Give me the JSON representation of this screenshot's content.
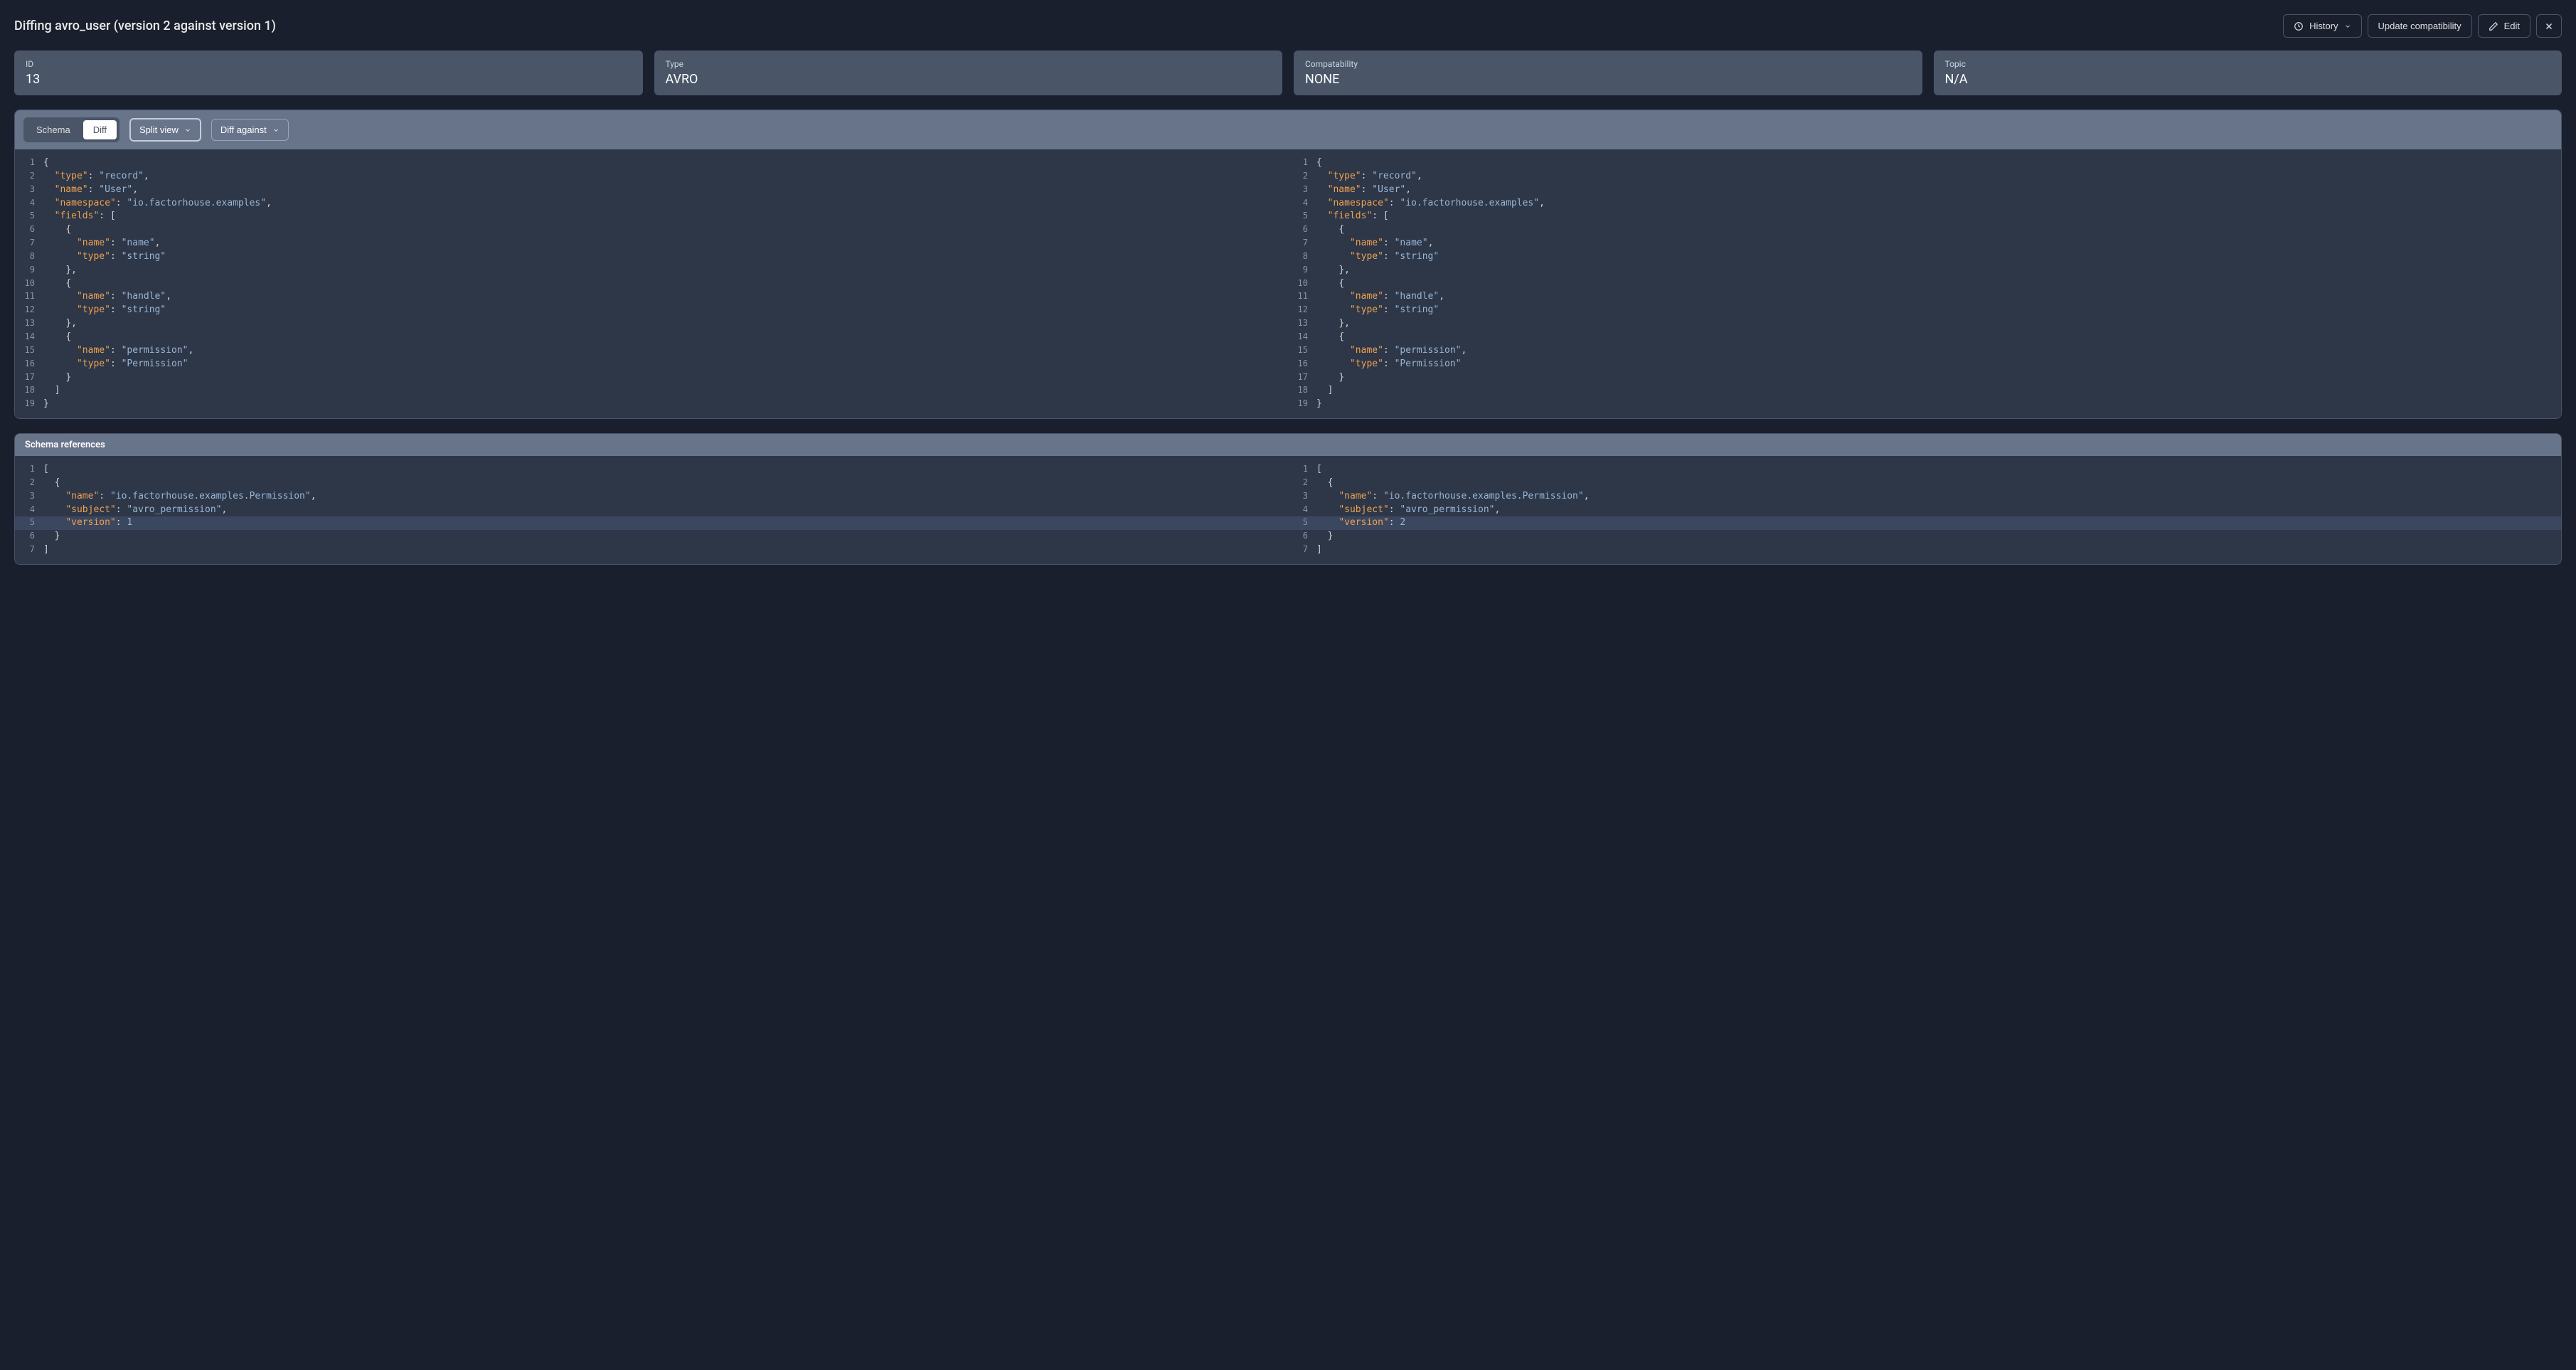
{
  "title": "Diffing avro_user (version 2 against version 1)",
  "actions": {
    "history": "History",
    "update": "Update compatibility",
    "edit": "Edit"
  },
  "cards": [
    {
      "label": "ID",
      "value": "13"
    },
    {
      "label": "Type",
      "value": "AVRO"
    },
    {
      "label": "Compatability",
      "value": "NONE"
    },
    {
      "label": "Topic",
      "value": "N/A"
    }
  ],
  "toolbar": {
    "schema_tab": "Schema",
    "diff_tab": "Diff",
    "split_view": "Split view",
    "diff_against": "Diff against"
  },
  "schema_left": [
    {
      "n": 1,
      "tokens": [
        {
          "t": "punc",
          "v": "{"
        }
      ]
    },
    {
      "n": 2,
      "tokens": [
        {
          "t": "ind",
          "v": "  "
        },
        {
          "t": "key",
          "v": "\"type\""
        },
        {
          "t": "punc",
          "v": ": "
        },
        {
          "t": "str",
          "v": "\"record\""
        },
        {
          "t": "punc",
          "v": ","
        }
      ]
    },
    {
      "n": 3,
      "tokens": [
        {
          "t": "ind",
          "v": "  "
        },
        {
          "t": "key",
          "v": "\"name\""
        },
        {
          "t": "punc",
          "v": ": "
        },
        {
          "t": "str",
          "v": "\"User\""
        },
        {
          "t": "punc",
          "v": ","
        }
      ]
    },
    {
      "n": 4,
      "tokens": [
        {
          "t": "ind",
          "v": "  "
        },
        {
          "t": "key",
          "v": "\"namespace\""
        },
        {
          "t": "punc",
          "v": ": "
        },
        {
          "t": "str",
          "v": "\"io.factorhouse.examples\""
        },
        {
          "t": "punc",
          "v": ","
        }
      ]
    },
    {
      "n": 5,
      "tokens": [
        {
          "t": "ind",
          "v": "  "
        },
        {
          "t": "key",
          "v": "\"fields\""
        },
        {
          "t": "punc",
          "v": ": ["
        }
      ]
    },
    {
      "n": 6,
      "tokens": [
        {
          "t": "ind",
          "v": "    "
        },
        {
          "t": "punc",
          "v": "{"
        }
      ]
    },
    {
      "n": 7,
      "tokens": [
        {
          "t": "ind",
          "v": "      "
        },
        {
          "t": "key",
          "v": "\"name\""
        },
        {
          "t": "punc",
          "v": ": "
        },
        {
          "t": "str",
          "v": "\"name\""
        },
        {
          "t": "punc",
          "v": ","
        }
      ]
    },
    {
      "n": 8,
      "tokens": [
        {
          "t": "ind",
          "v": "      "
        },
        {
          "t": "key",
          "v": "\"type\""
        },
        {
          "t": "punc",
          "v": ": "
        },
        {
          "t": "str",
          "v": "\"string\""
        }
      ]
    },
    {
      "n": 9,
      "tokens": [
        {
          "t": "ind",
          "v": "    "
        },
        {
          "t": "punc",
          "v": "},"
        }
      ]
    },
    {
      "n": 10,
      "tokens": [
        {
          "t": "ind",
          "v": "    "
        },
        {
          "t": "punc",
          "v": "{"
        }
      ]
    },
    {
      "n": 11,
      "tokens": [
        {
          "t": "ind",
          "v": "      "
        },
        {
          "t": "key",
          "v": "\"name\""
        },
        {
          "t": "punc",
          "v": ": "
        },
        {
          "t": "str",
          "v": "\"handle\""
        },
        {
          "t": "punc",
          "v": ","
        }
      ]
    },
    {
      "n": 12,
      "tokens": [
        {
          "t": "ind",
          "v": "      "
        },
        {
          "t": "key",
          "v": "\"type\""
        },
        {
          "t": "punc",
          "v": ": "
        },
        {
          "t": "str",
          "v": "\"string\""
        }
      ]
    },
    {
      "n": 13,
      "tokens": [
        {
          "t": "ind",
          "v": "    "
        },
        {
          "t": "punc",
          "v": "},"
        }
      ]
    },
    {
      "n": 14,
      "tokens": [
        {
          "t": "ind",
          "v": "    "
        },
        {
          "t": "punc",
          "v": "{"
        }
      ]
    },
    {
      "n": 15,
      "tokens": [
        {
          "t": "ind",
          "v": "      "
        },
        {
          "t": "key",
          "v": "\"name\""
        },
        {
          "t": "punc",
          "v": ": "
        },
        {
          "t": "str",
          "v": "\"permission\""
        },
        {
          "t": "punc",
          "v": ","
        }
      ]
    },
    {
      "n": 16,
      "tokens": [
        {
          "t": "ind",
          "v": "      "
        },
        {
          "t": "key",
          "v": "\"type\""
        },
        {
          "t": "punc",
          "v": ": "
        },
        {
          "t": "str",
          "v": "\"Permission\""
        }
      ]
    },
    {
      "n": 17,
      "tokens": [
        {
          "t": "ind",
          "v": "    "
        },
        {
          "t": "punc",
          "v": "}"
        }
      ]
    },
    {
      "n": 18,
      "tokens": [
        {
          "t": "ind",
          "v": "  "
        },
        {
          "t": "punc",
          "v": "]"
        }
      ]
    },
    {
      "n": 19,
      "tokens": [
        {
          "t": "punc",
          "v": "}"
        }
      ]
    }
  ],
  "schema_right": [
    {
      "n": 1,
      "tokens": [
        {
          "t": "punc",
          "v": "{"
        }
      ]
    },
    {
      "n": 2,
      "tokens": [
        {
          "t": "ind",
          "v": "  "
        },
        {
          "t": "key",
          "v": "\"type\""
        },
        {
          "t": "punc",
          "v": ": "
        },
        {
          "t": "str",
          "v": "\"record\""
        },
        {
          "t": "punc",
          "v": ","
        }
      ]
    },
    {
      "n": 3,
      "tokens": [
        {
          "t": "ind",
          "v": "  "
        },
        {
          "t": "key",
          "v": "\"name\""
        },
        {
          "t": "punc",
          "v": ": "
        },
        {
          "t": "str",
          "v": "\"User\""
        },
        {
          "t": "punc",
          "v": ","
        }
      ]
    },
    {
      "n": 4,
      "tokens": [
        {
          "t": "ind",
          "v": "  "
        },
        {
          "t": "key",
          "v": "\"namespace\""
        },
        {
          "t": "punc",
          "v": ": "
        },
        {
          "t": "str",
          "v": "\"io.factorhouse.examples\""
        },
        {
          "t": "punc",
          "v": ","
        }
      ]
    },
    {
      "n": 5,
      "tokens": [
        {
          "t": "ind",
          "v": "  "
        },
        {
          "t": "key",
          "v": "\"fields\""
        },
        {
          "t": "punc",
          "v": ": ["
        }
      ]
    },
    {
      "n": 6,
      "tokens": [
        {
          "t": "ind",
          "v": "    "
        },
        {
          "t": "punc",
          "v": "{"
        }
      ]
    },
    {
      "n": 7,
      "tokens": [
        {
          "t": "ind",
          "v": "      "
        },
        {
          "t": "key",
          "v": "\"name\""
        },
        {
          "t": "punc",
          "v": ": "
        },
        {
          "t": "str",
          "v": "\"name\""
        },
        {
          "t": "punc",
          "v": ","
        }
      ]
    },
    {
      "n": 8,
      "tokens": [
        {
          "t": "ind",
          "v": "      "
        },
        {
          "t": "key",
          "v": "\"type\""
        },
        {
          "t": "punc",
          "v": ": "
        },
        {
          "t": "str",
          "v": "\"string\""
        }
      ]
    },
    {
      "n": 9,
      "tokens": [
        {
          "t": "ind",
          "v": "    "
        },
        {
          "t": "punc",
          "v": "},"
        }
      ]
    },
    {
      "n": 10,
      "tokens": [
        {
          "t": "ind",
          "v": "    "
        },
        {
          "t": "punc",
          "v": "{"
        }
      ]
    },
    {
      "n": 11,
      "tokens": [
        {
          "t": "ind",
          "v": "      "
        },
        {
          "t": "key",
          "v": "\"name\""
        },
        {
          "t": "punc",
          "v": ": "
        },
        {
          "t": "str",
          "v": "\"handle\""
        },
        {
          "t": "punc",
          "v": ","
        }
      ]
    },
    {
      "n": 12,
      "tokens": [
        {
          "t": "ind",
          "v": "      "
        },
        {
          "t": "key",
          "v": "\"type\""
        },
        {
          "t": "punc",
          "v": ": "
        },
        {
          "t": "str",
          "v": "\"string\""
        }
      ]
    },
    {
      "n": 13,
      "tokens": [
        {
          "t": "ind",
          "v": "    "
        },
        {
          "t": "punc",
          "v": "},"
        }
      ]
    },
    {
      "n": 14,
      "tokens": [
        {
          "t": "ind",
          "v": "    "
        },
        {
          "t": "punc",
          "v": "{"
        }
      ]
    },
    {
      "n": 15,
      "tokens": [
        {
          "t": "ind",
          "v": "      "
        },
        {
          "t": "key",
          "v": "\"name\""
        },
        {
          "t": "punc",
          "v": ": "
        },
        {
          "t": "str",
          "v": "\"permission\""
        },
        {
          "t": "punc",
          "v": ","
        }
      ]
    },
    {
      "n": 16,
      "tokens": [
        {
          "t": "ind",
          "v": "      "
        },
        {
          "t": "key",
          "v": "\"type\""
        },
        {
          "t": "punc",
          "v": ": "
        },
        {
          "t": "str",
          "v": "\"Permission\""
        }
      ]
    },
    {
      "n": 17,
      "tokens": [
        {
          "t": "ind",
          "v": "    "
        },
        {
          "t": "punc",
          "v": "}"
        }
      ]
    },
    {
      "n": 18,
      "tokens": [
        {
          "t": "ind",
          "v": "  "
        },
        {
          "t": "punc",
          "v": "]"
        }
      ]
    },
    {
      "n": 19,
      "tokens": [
        {
          "t": "punc",
          "v": "}"
        }
      ]
    }
  ],
  "refs_header": "Schema references",
  "refs_left": [
    {
      "n": 1,
      "tokens": [
        {
          "t": "punc",
          "v": "["
        }
      ]
    },
    {
      "n": 2,
      "tokens": [
        {
          "t": "ind",
          "v": "  "
        },
        {
          "t": "punc",
          "v": "{"
        }
      ]
    },
    {
      "n": 3,
      "tokens": [
        {
          "t": "ind",
          "v": "    "
        },
        {
          "t": "key",
          "v": "\"name\""
        },
        {
          "t": "punc",
          "v": ": "
        },
        {
          "t": "str",
          "v": "\"io.factorhouse.examples.Permission\""
        },
        {
          "t": "punc",
          "v": ","
        }
      ]
    },
    {
      "n": 4,
      "tokens": [
        {
          "t": "ind",
          "v": "    "
        },
        {
          "t": "key",
          "v": "\"subject\""
        },
        {
          "t": "punc",
          "v": ": "
        },
        {
          "t": "str",
          "v": "\"avro_permission\""
        },
        {
          "t": "punc",
          "v": ","
        }
      ]
    },
    {
      "n": 5,
      "hl": true,
      "tokens": [
        {
          "t": "ind",
          "v": "    "
        },
        {
          "t": "key",
          "v": "\"version\""
        },
        {
          "t": "punc",
          "v": ": "
        },
        {
          "t": "num",
          "v": "1"
        }
      ]
    },
    {
      "n": 6,
      "tokens": [
        {
          "t": "ind",
          "v": "  "
        },
        {
          "t": "punc",
          "v": "}"
        }
      ]
    },
    {
      "n": 7,
      "tokens": [
        {
          "t": "punc",
          "v": "]"
        }
      ]
    }
  ],
  "refs_right": [
    {
      "n": 1,
      "tokens": [
        {
          "t": "punc",
          "v": "["
        }
      ]
    },
    {
      "n": 2,
      "tokens": [
        {
          "t": "ind",
          "v": "  "
        },
        {
          "t": "punc",
          "v": "{"
        }
      ]
    },
    {
      "n": 3,
      "tokens": [
        {
          "t": "ind",
          "v": "    "
        },
        {
          "t": "key",
          "v": "\"name\""
        },
        {
          "t": "punc",
          "v": ": "
        },
        {
          "t": "str",
          "v": "\"io.factorhouse.examples.Permission\""
        },
        {
          "t": "punc",
          "v": ","
        }
      ]
    },
    {
      "n": 4,
      "tokens": [
        {
          "t": "ind",
          "v": "    "
        },
        {
          "t": "key",
          "v": "\"subject\""
        },
        {
          "t": "punc",
          "v": ": "
        },
        {
          "t": "str",
          "v": "\"avro_permission\""
        },
        {
          "t": "punc",
          "v": ","
        }
      ]
    },
    {
      "n": 5,
      "hl": true,
      "tokens": [
        {
          "t": "ind",
          "v": "    "
        },
        {
          "t": "key",
          "v": "\"version\""
        },
        {
          "t": "punc",
          "v": ": "
        },
        {
          "t": "num",
          "v": "2"
        }
      ]
    },
    {
      "n": 6,
      "tokens": [
        {
          "t": "ind",
          "v": "  "
        },
        {
          "t": "punc",
          "v": "}"
        }
      ]
    },
    {
      "n": 7,
      "tokens": [
        {
          "t": "punc",
          "v": "]"
        }
      ]
    }
  ]
}
